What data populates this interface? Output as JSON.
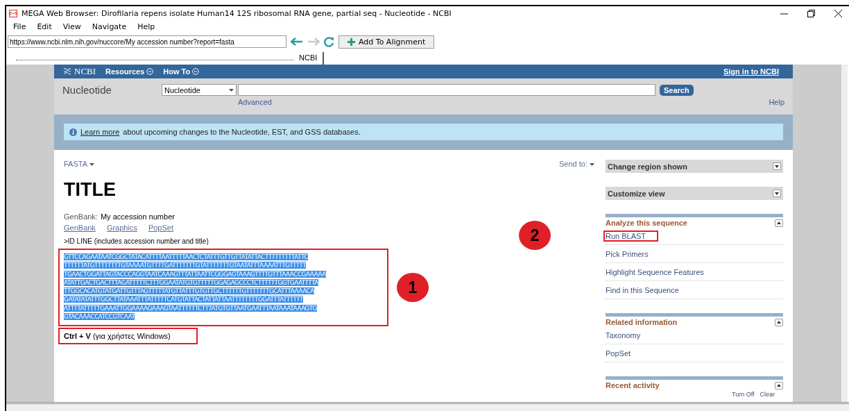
{
  "window": {
    "title": "MEGA Web Browser: Dirofilaria repens isolate Human14 12S ribosomal RNA gene, partial seq - Nucleotide - NCBI"
  },
  "menu": [
    "File",
    "Edit",
    "View",
    "Navigate",
    "Help"
  ],
  "address": {
    "value": "https://www.ncbi.nlm.nih.gov/nuccore/My accession number?report=fasta"
  },
  "add_button": "Add To Alignment",
  "tabs": [
    {
      "label": "NCBI",
      "selected": true
    }
  ],
  "ncbi_bar": {
    "logo": "NCBI",
    "links": [
      "Resources",
      "How To"
    ],
    "sign_in": "Sign in to NCBI"
  },
  "search": {
    "db_label": "Nucleotide",
    "select_value": "Nucleotide",
    "button": "Search",
    "advanced": "Advanced",
    "help": "Help"
  },
  "notice": {
    "link": "Learn more",
    "text": "about upcoming changes to the Nucleotide, EST, and GSS databases."
  },
  "format": "FASTA",
  "send_to": "Send to:",
  "title": "TITLE",
  "genbank": {
    "label": "GenBank:",
    "value": "My accession number"
  },
  "views": [
    "GenBank",
    "Graphics",
    "PopSet"
  ],
  "id_line": ">ID LINE (includes accession number and title)",
  "sequence": {
    "selected": true,
    "lines": [
      "GTTCCAGAATAATCGGCTATACATTTTAATTTTTAACTCTATTTGTTGTTATATTACTTTTTTTTTATTC",
      "TTTTTTATGTTTTTTTTGTAAAATGTTTTGATTTTTTTGTATTTTTTTGTAATATTTAAAATTTGTTTTT",
      "TGAACTGGATTAGTACCCAGGTAATCAAAGTTTATTAATTCGGGAGTAAAGTTTTGTTTAAACCGAAAAA",
      "ATATTGACTGACTTTAGATTTTTCTTTGGAATATGTGTTTTTGGAGAGCCCTCTTTTTTGGTGAATTTTA",
      "TTGGCACATGTATGATTGTTTAGTTTTTATGTTATTTGTGTTGCTTTTTTGTTTTTTTGCATTTAAAACA",
      "GATATATATTTGGCTTATAAATTTATTTTTCATGTATTACTATTATTAATTTTTTTTGGATTTATTTTTT",
      "ATTTTATTTTTGAAATTGGAAAAGAAAGTAATTTTTTCTTTATGTGTTAATGAATTTAATAAATAAAGTG",
      "GTACAAACCATCCGTCAAT"
    ]
  },
  "paste_hint": "**Ctrl + V** (για χρήστες Windows)",
  "callouts": [
    "1",
    "2"
  ],
  "sidebar": [
    {
      "kind": "dropdown",
      "title": "Change region shown"
    },
    {
      "kind": "dropdown",
      "title": "Customize view"
    },
    {
      "kind": "section",
      "title": "Analyze this sequence",
      "links": [
        {
          "label": "Run BLAST",
          "highlighted": true
        },
        {
          "label": "Pick Primers",
          "highlighted": false
        },
        {
          "label": "Highlight Sequence Features",
          "highlighted": false
        },
        {
          "label": "Find in this Sequence",
          "highlighted": false
        }
      ]
    },
    {
      "kind": "section",
      "title": "Related information",
      "links": [
        {
          "label": "Taxonomy",
          "highlighted": false
        },
        {
          "label": "PopSet",
          "highlighted": false
        }
      ]
    },
    {
      "kind": "section",
      "title": "Recent activity",
      "footer": [
        "Turn Off",
        "Clear"
      ]
    }
  ]
}
